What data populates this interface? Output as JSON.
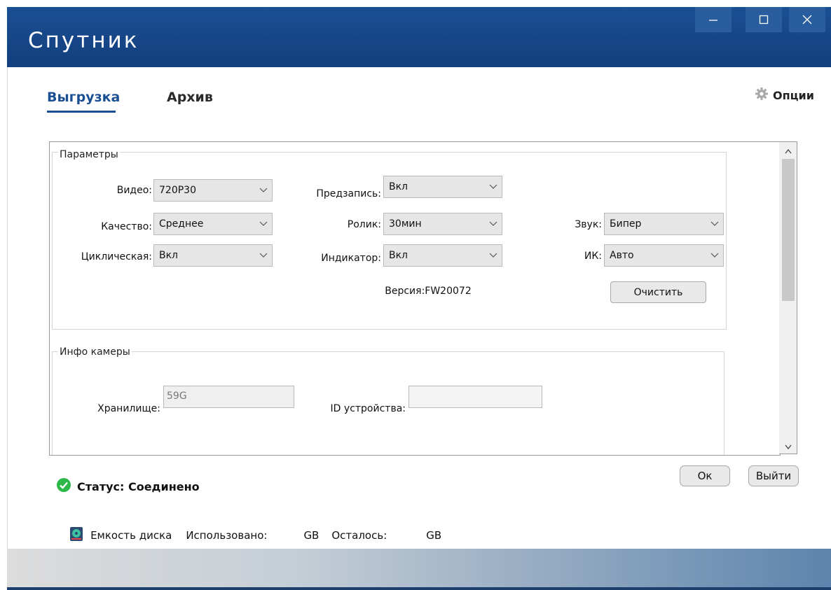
{
  "window": {
    "title": "Спутник",
    "controls": [
      "minimize-icon",
      "maximize-icon",
      "close-icon"
    ]
  },
  "tabs": [
    {
      "label": "Выгрузка",
      "active": true
    },
    {
      "label": "Архив",
      "active": false
    }
  ],
  "options": {
    "label": "Опции",
    "icon": "gear-icon"
  },
  "params": {
    "title": "Параметры",
    "video": {
      "label": "Видео:",
      "value": "720P30"
    },
    "quality": {
      "label": "Качество:",
      "value": "Среднее"
    },
    "cyclic": {
      "label": "Циклическая:",
      "value": "Вкл"
    },
    "prerecord": {
      "label": "Предзапись:",
      "value": "Вкл"
    },
    "clip": {
      "label": "Ролик:",
      "value": "30мин"
    },
    "indicator": {
      "label": "Индикатор:",
      "value": "Вкл"
    },
    "sound": {
      "label": "Звук:",
      "value": "Бипер"
    },
    "ir": {
      "label": "ИК:",
      "value": "Авто"
    },
    "version": "Версия:FW20072",
    "clear_label": "Очистить"
  },
  "camera": {
    "title": "Инфо камеры",
    "storage": {
      "label": "Хранилище:",
      "value": "59G"
    },
    "device_id": {
      "label": "ID устройства:",
      "value": ""
    }
  },
  "buttons": {
    "ok": "Ок",
    "exit": "Выйти"
  },
  "status": {
    "text": "Статус: Соединено",
    "color": "#2eb84a"
  },
  "disk": {
    "label": "Емкость диска",
    "used_label": "Использовано:",
    "used_unit": "GB",
    "left_label": "Осталось:",
    "left_unit": "GB"
  },
  "colors": {
    "accent": "#1b4f94",
    "title_bar": "#1b4f94"
  }
}
